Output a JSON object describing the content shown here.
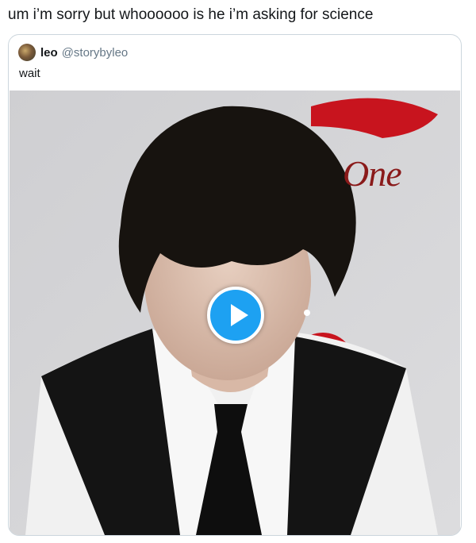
{
  "tweet": {
    "text": "um i’m sorry but whoooooo is he i’m asking for science"
  },
  "quoted": {
    "name": "leo",
    "handle": "@storybyleo",
    "text": "wait",
    "brand_text": "One"
  },
  "colors": {
    "accent": "#1da1f2",
    "border": "#ccd6dd",
    "muted": "#657786"
  },
  "icons": {
    "play": "play-icon"
  }
}
